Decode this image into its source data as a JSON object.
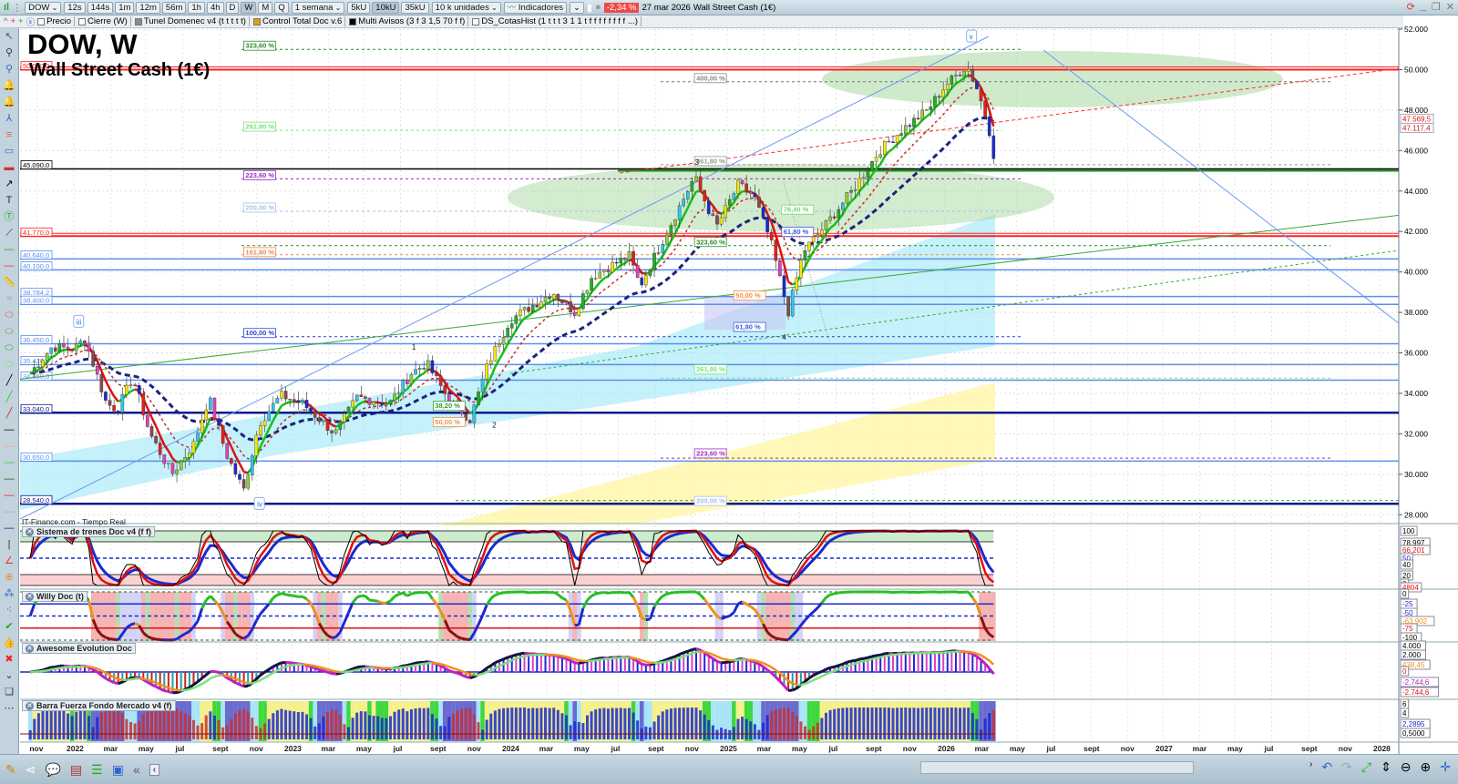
{
  "toolbar": {
    "symbol": "DOW",
    "timeframes": [
      "12s",
      "144s",
      "1m",
      "12m",
      "56m",
      "1h",
      "4h",
      "D",
      "W",
      "M",
      "Q"
    ],
    "active_timeframe": "W",
    "period": "1 semana",
    "units": [
      "5kU",
      "10kU",
      "35kU"
    ],
    "active_unit": "10kU",
    "units_dropdown": "10 k unidades",
    "indicators": "Indicadores",
    "change": "-2,34 %",
    "date": "27 mar 2026",
    "instrument": "Wall Street Cash (1€)"
  },
  "legend": [
    "Precio",
    "Cierre (W)",
    "Tunel Domenec v4 (t t t t t)",
    "Control Total Doc v.6",
    "Multi Avisos (3 f 3 1,5 70 f f)",
    "DS_CotasHist (1 t t t 3 1 1 t f f f f f f f f ...)"
  ],
  "header": {
    "title": "DOW, W",
    "subtitle": "Wall Street Cash (1€)",
    "source": "IT-Finance.com - Tiempo Real"
  },
  "colors": {
    "up": "#21c021",
    "down": "#e01010",
    "accent": "#1a237e",
    "negative_badge": "#f04848"
  },
  "price_axis": [
    "52.000",
    "50.000",
    "48.000",
    "46.000",
    "44.000",
    "42.000",
    "40.000",
    "38.000",
    "36.000",
    "34.000",
    "32.000",
    "30.000",
    "28.000"
  ],
  "price_ticks": [
    52000,
    50000,
    48000,
    46000,
    44000,
    42000,
    40000,
    38000,
    36000,
    34000,
    32000,
    30000,
    28000
  ],
  "right_tags": [
    {
      "text": "47.569,5",
      "value": 47569.5,
      "color": "#e01010"
    },
    {
      "text": "47.117,4",
      "value": 47117.4,
      "color": "#e01010"
    }
  ],
  "levels": [
    {
      "text": "50.000,0",
      "value": 50000,
      "color": "#ff2020"
    },
    {
      "text": "45.090,0",
      "value": 45090,
      "color": "#000000"
    },
    {
      "text": "41.770,0",
      "value": 41770,
      "color": "#ff2020"
    },
    {
      "text": "40.640,0",
      "value": 40640,
      "color": "#5b8ef0"
    },
    {
      "text": "40.100,0",
      "value": 40100,
      "color": "#5b8ef0"
    },
    {
      "text": "38.784,2",
      "value": 38784.2,
      "color": "#5b8ef0"
    },
    {
      "text": "38.400,0",
      "value": 38400,
      "color": "#5b8ef0"
    },
    {
      "text": "36.450,0",
      "value": 36450,
      "color": "#5b8ef0"
    },
    {
      "text": "35.420,0",
      "value": 35420,
      "color": "#5b8ef0"
    },
    {
      "text": "34.650,0",
      "value": 34650,
      "color": "#5b8ef0"
    },
    {
      "text": "33.040,0",
      "value": 33040,
      "color": "#0a1a8c"
    },
    {
      "text": "30.650,0",
      "value": 30650,
      "color": "#5b8ef0"
    },
    {
      "text": "28.540,0",
      "value": 28540,
      "color": "#0a1a8c"
    }
  ],
  "fib_labels": [
    {
      "text": "323,60 %",
      "color": "#2e8b2e",
      "value": 51000,
      "t": 2022.78
    },
    {
      "text": "400,00 %",
      "color": "#888888",
      "value": 49400,
      "t": 2024.85
    },
    {
      "text": "261,80 %",
      "color": "#7ee07e",
      "value": 47000,
      "t": 2022.78
    },
    {
      "text": "361,80 %",
      "color": "#999999",
      "value": 45300,
      "t": 2024.85
    },
    {
      "text": "223,60 %",
      "color": "#9a2ec0",
      "value": 44600,
      "t": 2022.78
    },
    {
      "text": "200,00 %",
      "color": "#a9c0ee",
      "value": 43000,
      "t": 2022.78
    },
    {
      "text": "76,40 %",
      "color": "#6fd46f",
      "value": 42900,
      "t": 2025.25
    },
    {
      "text": "61,80 %",
      "color": "#3a5ee0",
      "value": 41800,
      "t": 2025.25
    },
    {
      "text": "323,60 %",
      "color": "#2e8b2e",
      "value": 41300,
      "t": 2024.85
    },
    {
      "text": "161,80 %",
      "color": "#f08a4a",
      "value": 40800,
      "t": 2022.78
    },
    {
      "text": "50,00 %",
      "color": "#f0904a",
      "value": 38650,
      "t": 2025.03
    },
    {
      "text": "61,80 %",
      "color": "#3a5ee0",
      "value": 37100,
      "t": 2025.03
    },
    {
      "text": "100,00 %",
      "color": "#2a40d0",
      "value": 36800,
      "t": 2022.78
    },
    {
      "text": "261,80 %",
      "color": "#7ee07e",
      "value": 35000,
      "t": 2024.85
    },
    {
      "text": "38,20 %",
      "color": "#2ea02e",
      "value": 33200,
      "t": 2023.65
    },
    {
      "text": "50,00 %",
      "color": "#f0904a",
      "value": 32400,
      "t": 2023.65
    },
    {
      "text": "223,60 %",
      "color": "#9a2ec0",
      "value": 30850,
      "t": 2024.85
    },
    {
      "text": "200,00 %",
      "color": "#a9c0ee",
      "value": 28500,
      "t": 2024.85
    }
  ],
  "wave_labels": [
    {
      "text": "5",
      "t": 2026.2,
      "value": 52400,
      "boxed": true
    },
    {
      "text": "v",
      "t": 2026.12,
      "value": 51500,
      "boxed": true
    },
    {
      "text": "iii",
      "t": 2022.02,
      "value": 37400,
      "boxed": true
    },
    {
      "text": "iv",
      "t": 2022.85,
      "value": 28400,
      "boxed": true
    },
    {
      "text": "3",
      "t": 2024.86,
      "value": 45300,
      "boxed": false
    },
    {
      "text": "1",
      "t": 2023.56,
      "value": 36150,
      "boxed": false
    },
    {
      "text": "2",
      "t": 2023.93,
      "value": 32300,
      "boxed": false
    },
    {
      "text": "4",
      "t": 2025.26,
      "value": 36650,
      "boxed": false
    }
  ],
  "indicators": [
    {
      "name": "Sistema de trenes Doc v4 (f f)",
      "tags": [
        {
          "text": "100",
          "color": "#000"
        },
        {
          "text": "78,997",
          "color": "#000"
        },
        {
          "text": "66,201",
          "color": "#e01010"
        },
        {
          "text": "50",
          "color": "#1a2ad0"
        },
        {
          "text": "40",
          "color": "#000"
        },
        {
          "text": "20",
          "color": "#000"
        },
        {
          "text": "0",
          "color": "#000"
        },
        {
          "text": "4804",
          "color": "#e01010"
        }
      ]
    },
    {
      "name": "Willy Doc (t)",
      "tags": [
        {
          "text": "0",
          "color": "#000"
        },
        {
          "text": "-25",
          "color": "#1a2ad0"
        },
        {
          "text": "-50",
          "color": "#1a2ad0"
        },
        {
          "text": "-63,902",
          "color": "#f0901a"
        },
        {
          "text": "-75",
          "color": "#e01010"
        },
        {
          "text": "-100",
          "color": "#000"
        }
      ]
    },
    {
      "name": "Awesome Evolution Doc",
      "tags": [
        {
          "text": "4.000",
          "color": "#000"
        },
        {
          "text": "2.000",
          "color": "#000"
        },
        {
          "text": "438,45",
          "color": "#f0901a"
        },
        {
          "text": "0",
          "color": "#e01010"
        },
        {
          "text": "-2.744,6",
          "color": "#b020c0"
        },
        {
          "text": "-2.744,6",
          "color": "#e01010"
        }
      ]
    },
    {
      "name": "Barra Fuerza Fondo Mercado v4 (f)",
      "tags": [
        {
          "text": "6",
          "color": "#000"
        },
        {
          "text": "4",
          "color": "#000"
        },
        {
          "text": "2,2895",
          "color": "#1a2ad0"
        },
        {
          "text": "0,5000",
          "color": "#000"
        }
      ]
    }
  ],
  "time_axis": [
    {
      "label": "nov",
      "t": 2021.83
    },
    {
      "label": "2022",
      "t": 2022.0
    },
    {
      "label": "mar",
      "t": 2022.17
    },
    {
      "label": "may",
      "t": 2022.33
    },
    {
      "label": "jul",
      "t": 2022.5
    },
    {
      "label": "sept",
      "t": 2022.67
    },
    {
      "label": "nov",
      "t": 2022.84
    },
    {
      "label": "2023",
      "t": 2023.0
    },
    {
      "label": "mar",
      "t": 2023.17
    },
    {
      "label": "may",
      "t": 2023.33
    },
    {
      "label": "jul",
      "t": 2023.5
    },
    {
      "label": "sept",
      "t": 2023.67
    },
    {
      "label": "nov",
      "t": 2023.84
    },
    {
      "label": "2024",
      "t": 2024.0
    },
    {
      "label": "mar",
      "t": 2024.17
    },
    {
      "label": "may",
      "t": 2024.33
    },
    {
      "label": "jul",
      "t": 2024.5
    },
    {
      "label": "sept",
      "t": 2024.67
    },
    {
      "label": "nov",
      "t": 2024.84
    },
    {
      "label": "2025",
      "t": 2025.0
    },
    {
      "label": "mar",
      "t": 2025.17
    },
    {
      "label": "may",
      "t": 2025.33
    },
    {
      "label": "jul",
      "t": 2025.5
    },
    {
      "label": "sept",
      "t": 2025.67
    },
    {
      "label": "nov",
      "t": 2025.84
    },
    {
      "label": "2026",
      "t": 2026.0
    },
    {
      "label": "mar",
      "t": 2026.17
    },
    {
      "label": "may",
      "t": 2026.33
    },
    {
      "label": "jul",
      "t": 2026.5
    },
    {
      "label": "sept",
      "t": 2026.67
    },
    {
      "label": "nov",
      "t": 2026.84
    },
    {
      "label": "2027",
      "t": 2027.0
    },
    {
      "label": "mar",
      "t": 2027.17
    },
    {
      "label": "may",
      "t": 2027.33
    },
    {
      "label": "jul",
      "t": 2027.5
    },
    {
      "label": "sept",
      "t": 2027.67
    },
    {
      "label": "nov",
      "t": 2027.84
    },
    {
      "label": "2028",
      "t": 2028.0
    }
  ],
  "chart_data": {
    "type": "candlestick",
    "title": "DOW, W",
    "subtitle": "Wall Street Cash (1€)",
    "ylim": [
      28000,
      52000
    ],
    "xlim": [
      2021.78,
      2028.1
    ],
    "close_path": [
      [
        2021.8,
        35000
      ],
      [
        2021.9,
        36300
      ],
      [
        2022.0,
        36200
      ],
      [
        2022.05,
        36700
      ],
      [
        2022.15,
        33500
      ],
      [
        2022.2,
        33200
      ],
      [
        2022.27,
        34800
      ],
      [
        2022.35,
        32000
      ],
      [
        2022.45,
        30000
      ],
      [
        2022.55,
        31500
      ],
      [
        2022.62,
        33800
      ],
      [
        2022.7,
        31000
      ],
      [
        2022.78,
        29200
      ],
      [
        2022.85,
        32500
      ],
      [
        2022.95,
        33900
      ],
      [
        2023.05,
        33500
      ],
      [
        2023.2,
        32000
      ],
      [
        2023.3,
        33800
      ],
      [
        2023.45,
        33500
      ],
      [
        2023.55,
        35000
      ],
      [
        2023.62,
        35500
      ],
      [
        2023.72,
        33700
      ],
      [
        2023.82,
        32700
      ],
      [
        2023.9,
        35400
      ],
      [
        2024.0,
        37600
      ],
      [
        2024.2,
        39000
      ],
      [
        2024.3,
        38000
      ],
      [
        2024.38,
        39800
      ],
      [
        2024.55,
        40800
      ],
      [
        2024.6,
        39300
      ],
      [
        2024.7,
        41500
      ],
      [
        2024.85,
        44700
      ],
      [
        2024.95,
        42200
      ],
      [
        2025.05,
        44300
      ],
      [
        2025.12,
        43800
      ],
      [
        2025.2,
        41500
      ],
      [
        2025.28,
        38000
      ],
      [
        2025.35,
        41000
      ],
      [
        2025.45,
        42300
      ],
      [
        2025.58,
        44100
      ],
      [
        2025.7,
        46000
      ],
      [
        2025.8,
        47000
      ],
      [
        2025.92,
        48000
      ],
      [
        2026.0,
        49200
      ],
      [
        2026.1,
        50200
      ],
      [
        2026.15,
        49000
      ],
      [
        2026.2,
        47200
      ],
      [
        2026.235,
        45100
      ]
    ]
  }
}
